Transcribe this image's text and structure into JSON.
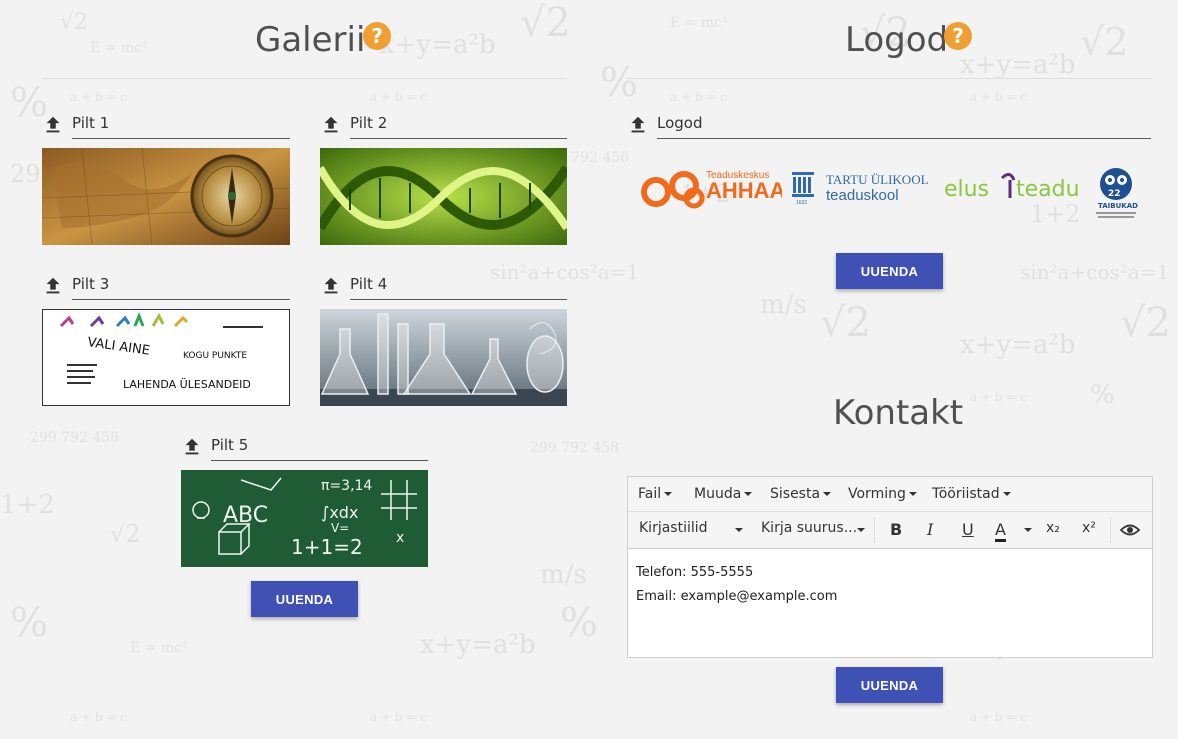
{
  "gallery": {
    "title": "Galerii",
    "help_icon": "?",
    "slots": [
      {
        "label": "Pilt 1",
        "icon": "upload-icon"
      },
      {
        "label": "Pilt 2",
        "icon": "upload-icon"
      },
      {
        "label": "Pilt 3",
        "icon": "upload-icon"
      },
      {
        "label": "Pilt 4",
        "icon": "upload-icon"
      },
      {
        "label": "Pilt 5",
        "icon": "upload-icon"
      }
    ],
    "pilt3": {
      "vali_aine": "VALI AINE",
      "kogu_punkte": "KOGU PUNKTE",
      "lahenda": "LAHENDA ÜLESANDEID"
    },
    "pilt5": {
      "abc": "ABC",
      "pi": "π=3,14",
      "integral": "∫xdx",
      "one_plus_one": "1+1=2",
      "v": "V=",
      "x": "x"
    },
    "update_button": "UUENDA"
  },
  "logos": {
    "title": "Logod",
    "help_icon": "?",
    "slot_label": "Logod",
    "ahhaa_top": "Teaduskeskus",
    "ahhaa_main": "AHHAA",
    "tartu_line1": "TARTU ÜLIKOOL",
    "tartu_line2": "teaduskool",
    "tartu_small": "1632",
    "elus_left": "elus",
    "elus_right": "teadus",
    "taibukad_number": "22",
    "taibukad_name": "TAIBUKAD",
    "update_button": "UUENDA"
  },
  "contact": {
    "title": "Kontakt",
    "menus": [
      "Fail",
      "Muuda",
      "Sisesta",
      "Vorming",
      "Tööriistad"
    ],
    "font_family": "Kirjastiilid",
    "font_size": "Kirja suurus...",
    "bold": "B",
    "italic": "I",
    "underline": "U",
    "text_color": "A",
    "subscript": "x₂",
    "superscript": "x²",
    "lines": [
      "Telefon: 555-5555",
      "Email: example@example.com"
    ],
    "update_button": "UUENDA"
  },
  "colors": {
    "accent": "#3f51b5",
    "help": "#f0a032",
    "ahhaa": "#f26a1b",
    "tartu": "#2f6aad",
    "elus_green": "#8cc63f"
  }
}
